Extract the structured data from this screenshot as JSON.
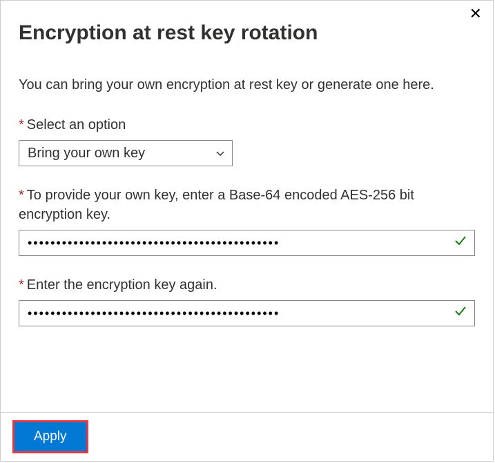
{
  "dialog": {
    "title": "Encryption at rest key rotation",
    "description": "You can bring your own encryption at rest key or generate one here.",
    "close_label": "Close"
  },
  "fields": {
    "option": {
      "label": "Select an option",
      "selected": "Bring your own key"
    },
    "key": {
      "label": "To provide your own key, enter a Base-64 encoded AES-256 bit encryption key.",
      "value": "••••••••••••••••••••••••••••••••••••••••••••"
    },
    "key_confirm": {
      "label": "Enter the encryption key again.",
      "value": "••••••••••••••••••••••••••••••••••••••••••••"
    }
  },
  "footer": {
    "apply_label": "Apply"
  }
}
